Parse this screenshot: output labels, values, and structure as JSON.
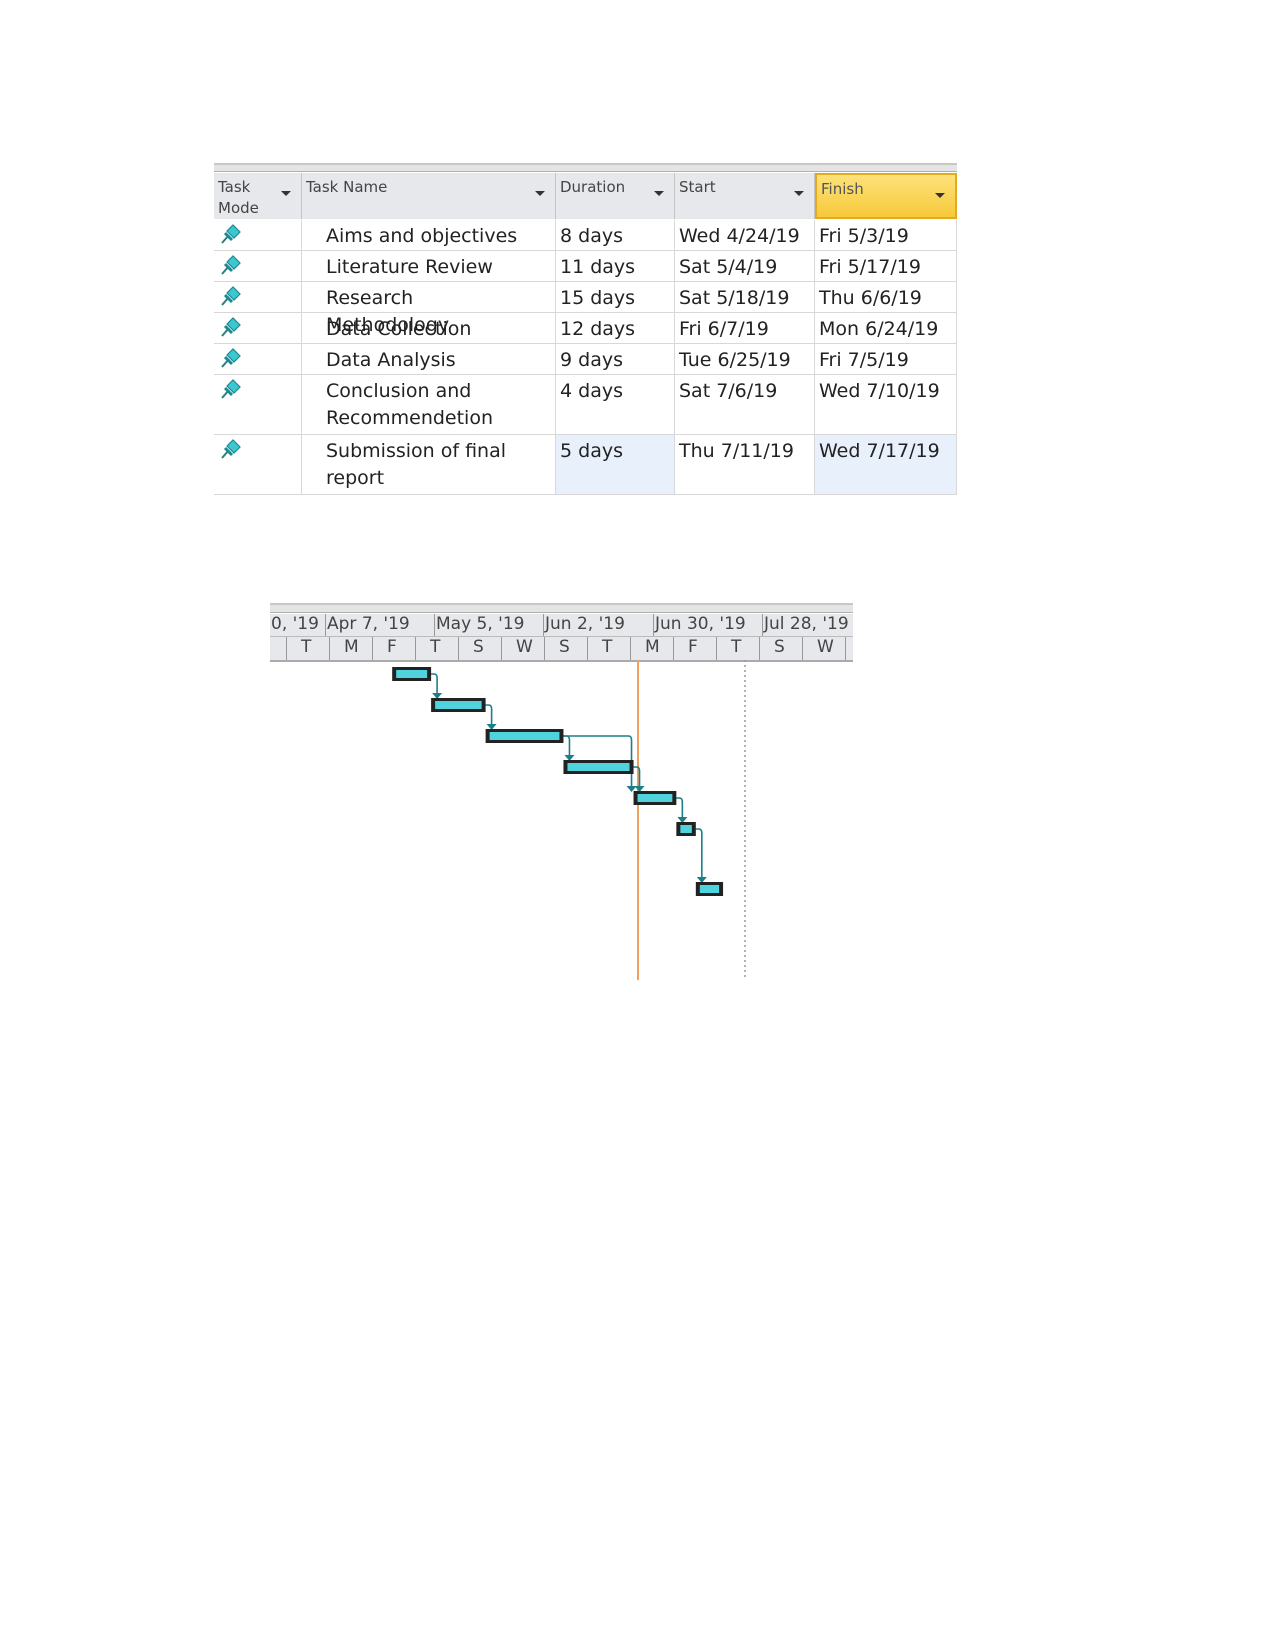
{
  "table": {
    "columns": [
      {
        "label": "Task Mode"
      },
      {
        "label": "Task Name"
      },
      {
        "label": "Duration"
      },
      {
        "label": "Start"
      },
      {
        "label": "Finish",
        "selected": true
      }
    ],
    "rows": [
      {
        "mode_icon": "manual-task-pin-icon",
        "name": "Aims and objectives",
        "duration": "8 days",
        "start": "Wed 4/24/19",
        "finish": "Fri 5/3/19"
      },
      {
        "mode_icon": "manual-task-pin-icon",
        "name": "Literature Review",
        "duration": "11 days",
        "start": "Sat 5/4/19",
        "finish": "Fri 5/17/19"
      },
      {
        "mode_icon": "manual-task-pin-icon",
        "name": "Research Methodology",
        "duration": "15 days",
        "start": "Sat 5/18/19",
        "finish": "Thu 6/6/19"
      },
      {
        "mode_icon": "manual-task-pin-icon",
        "name": "Data Collection",
        "duration": "12 days",
        "start": "Fri 6/7/19",
        "finish": "Mon 6/24/19"
      },
      {
        "mode_icon": "manual-task-pin-icon",
        "name": "Data Analysis",
        "duration": "9 days",
        "start": "Tue 6/25/19",
        "finish": "Fri 7/5/19"
      },
      {
        "mode_icon": "manual-task-pin-icon",
        "name": "Conclusion and Recommendetion",
        "duration": "4 days",
        "start": "Sat 7/6/19",
        "finish": "Wed 7/10/19"
      },
      {
        "mode_icon": "manual-task-pin-icon",
        "name": "Submission of final report",
        "duration": "5 days",
        "start": "Thu 7/11/19",
        "finish": "Wed 7/17/19"
      }
    ]
  },
  "gantt": {
    "top_tier": [
      "0, '19",
      "Apr 7, '19",
      "May 5, '19",
      "Jun 2, '19",
      "Jun 30, '19",
      "Jul 28, '19"
    ],
    "bottom_tier": [
      "T",
      "M",
      "F",
      "T",
      "S",
      "W",
      "S",
      "T",
      "M",
      "F",
      "T",
      "S",
      "W"
    ],
    "bars": [
      {
        "start": "2019-04-24",
        "finish": "2019-05-03",
        "predecessors": []
      },
      {
        "start": "2019-05-04",
        "finish": "2019-05-17",
        "predecessors": [
          1
        ]
      },
      {
        "start": "2019-05-18",
        "finish": "2019-06-06",
        "predecessors": [
          2
        ]
      },
      {
        "start": "2019-06-07",
        "finish": "2019-06-24",
        "predecessors": [
          3
        ]
      },
      {
        "start": "2019-06-25",
        "finish": "2019-07-05",
        "predecessors": [
          3,
          4
        ]
      },
      {
        "start": "2019-07-06",
        "finish": "2019-07-10",
        "predecessors": [
          5
        ]
      },
      {
        "start": "2019-07-11",
        "finish": "2019-07-17",
        "predecessors": [
          6
        ]
      }
    ],
    "colors": {
      "bar": "#4fd3dc",
      "bar_border": "#222222",
      "link": "#1a8088",
      "current_date_line": "#f0a060"
    }
  }
}
